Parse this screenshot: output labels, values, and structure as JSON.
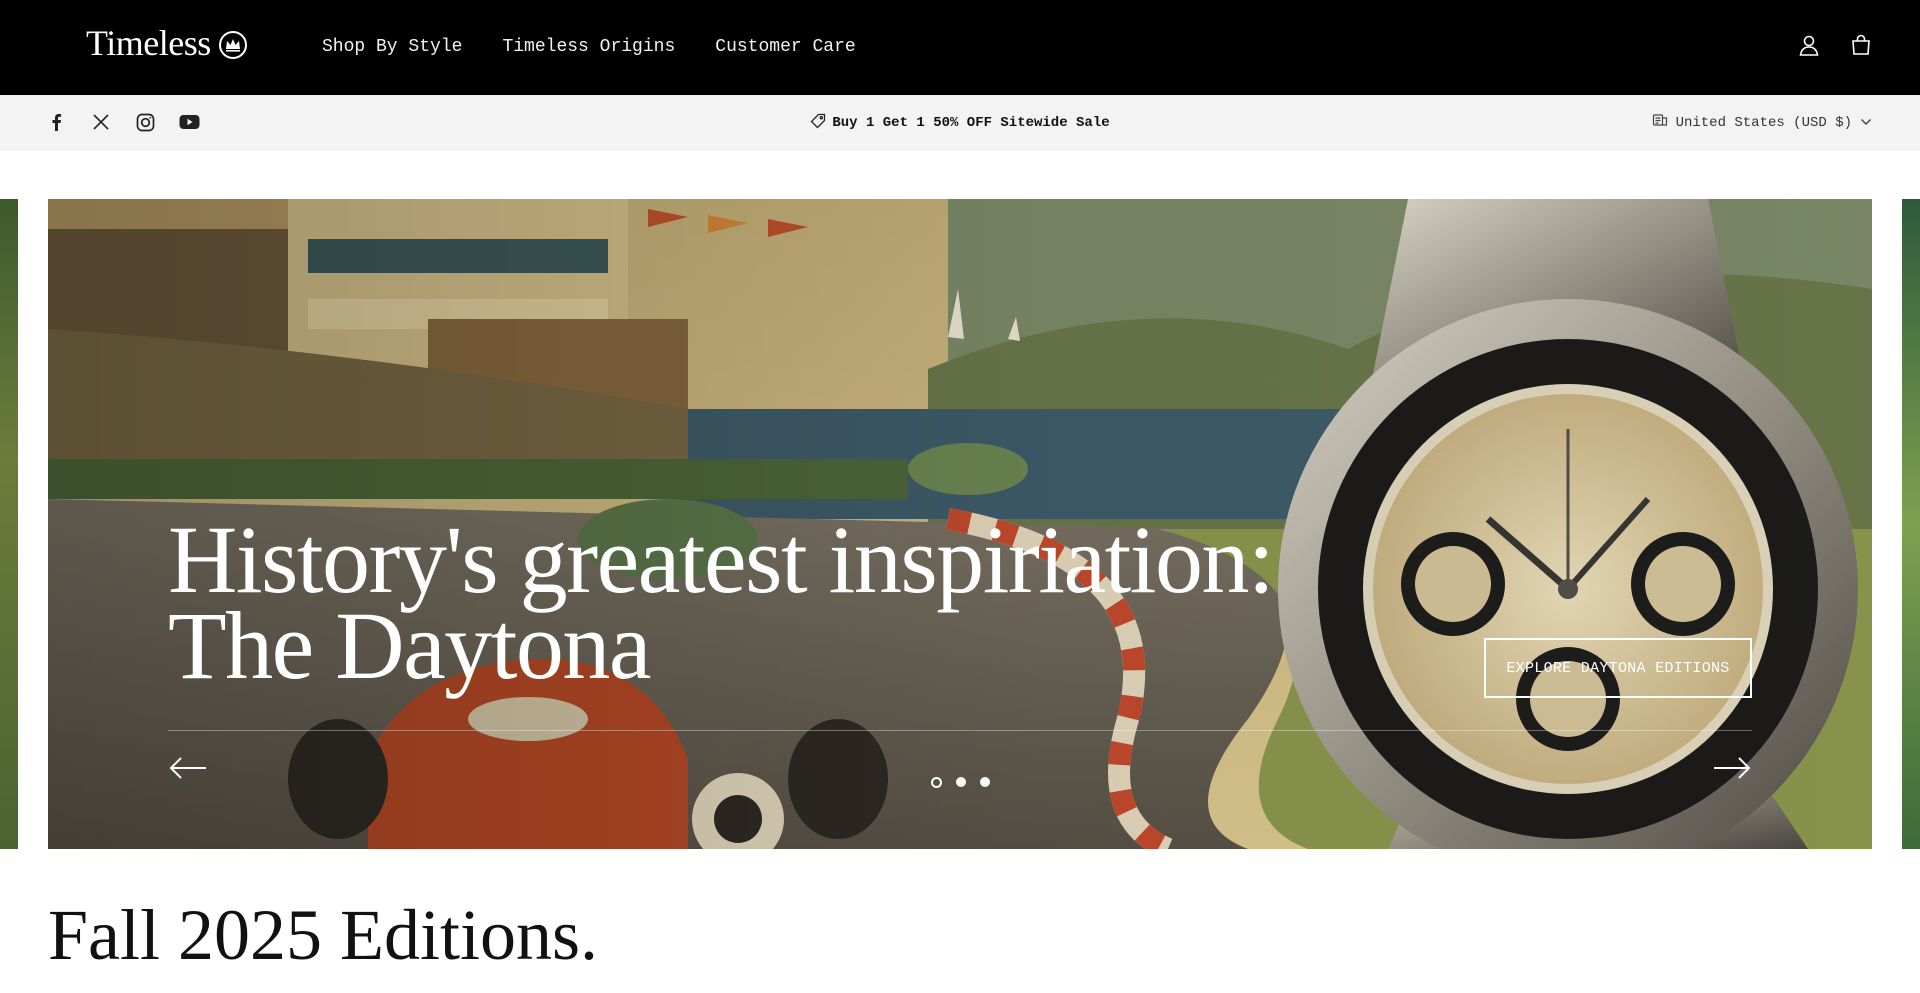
{
  "header": {
    "brand": "Timeless",
    "nav": [
      {
        "label": "Shop By Style"
      },
      {
        "label": "Timeless Origins"
      },
      {
        "label": "Customer Care"
      }
    ],
    "icons": [
      "account-icon",
      "cart-icon"
    ]
  },
  "announcement_bar": {
    "socials": [
      "facebook-icon",
      "x-icon",
      "instagram-icon",
      "youtube-icon"
    ],
    "message": "Buy 1 Get 1 50% OFF Sitewide Sale",
    "country_selector": "United States (USD $)"
  },
  "hero": {
    "heading_line1": "History's greatest inspiriation:",
    "heading_line2": "The Daytona",
    "cta_label": "EXPLORE DAYTONA EDITIONS",
    "slides": 3,
    "active_slide": 1
  },
  "collection": {
    "title": "Fall 2025 Editions."
  },
  "colors": {
    "header_bg": "#000000",
    "announcement_bg": "#f3f3f3",
    "text": "#111111"
  }
}
